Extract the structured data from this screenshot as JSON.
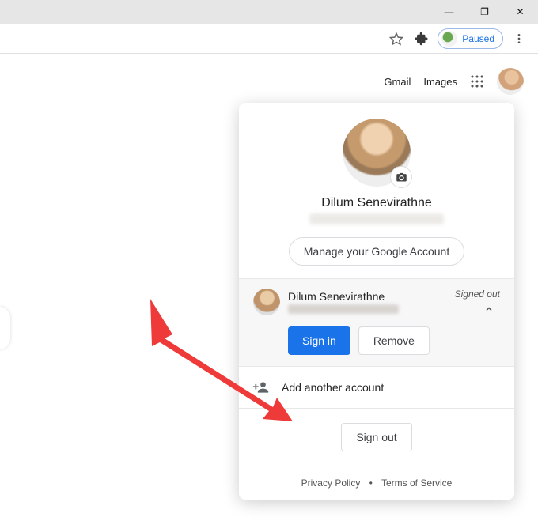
{
  "window": {
    "minimize": "—",
    "restore": "❐",
    "close": "✕"
  },
  "addressbar": {
    "paused_label": "Paused"
  },
  "topnav": {
    "gmail": "Gmail",
    "images": "Images"
  },
  "card": {
    "name": "Dilum Senevirathne",
    "manage_label": "Manage your Google Account",
    "account2": {
      "name": "Dilum Senevirathne",
      "status": "Signed out",
      "signin_label": "Sign in",
      "remove_label": "Remove"
    },
    "add_label": "Add another account",
    "signout_label": "Sign out",
    "privacy": "Privacy Policy",
    "terms": "Terms of Service"
  }
}
